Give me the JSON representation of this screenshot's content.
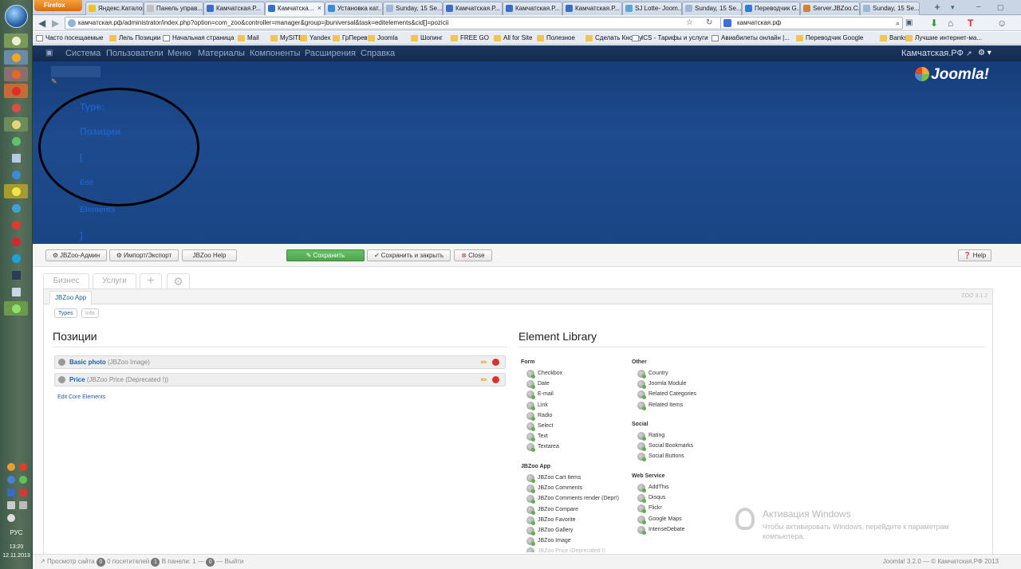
{
  "browser": {
    "menu_button": "Firefox",
    "tabs": [
      {
        "label": "Яндекс.Каталог"
      },
      {
        "label": "Панель управ..."
      },
      {
        "label": "Камчатская.Р..."
      },
      {
        "label": "Камчатска..."
      },
      {
        "label": "Установка кат..."
      },
      {
        "label": "Sunday, 15 Se..."
      },
      {
        "label": "Камчатская.Р..."
      },
      {
        "label": "Камчатская.Р..."
      },
      {
        "label": "Камчатская.Р..."
      },
      {
        "label": "SJ Lotte- Joom..."
      },
      {
        "label": "Sunday, 15 Se..."
      },
      {
        "label": "Переводчик G..."
      },
      {
        "label": "Server.JBZoo.C..."
      },
      {
        "label": "Sunday, 15 Se..."
      }
    ],
    "new_tab": "+",
    "url": "камчатская.рф/administrator/index.php?option=com_zoo&controller=manager&group=jbuniversal&task=editelements&cid[]=pozicii",
    "search": "камчатская.рф",
    "bookmarks": [
      "Часто посещаемые",
      "Лель Позиции",
      "Начальная страница",
      "Mail",
      "MySITE",
      "Yandex",
      "ГрПеревоз",
      "Joomla",
      "Шопинг",
      "FREE GO",
      "All for Site",
      "Полезное",
      "Сделать Кнопку",
      "ICS - Тарифы и услуги",
      "Авиабилеты онлайн |...",
      "Переводчик Google",
      "Banks",
      "Лучшие интернет-ма..."
    ]
  },
  "joomla": {
    "menu": [
      "Система",
      "Пользователи",
      "Меню",
      "Материалы",
      "Компоненты",
      "Расширения",
      "Справка"
    ],
    "site_name": "Камчатская.РФ",
    "logo_text": "Joomla!",
    "header_lines": [
      "Type:",
      "Позиции",
      "[",
      "Edit",
      "Elements",
      "]"
    ]
  },
  "toolbar": {
    "jbzoo_admin": "JBZoo-Админ",
    "import_export": "Импорт/Экспорт",
    "jbzoo_help": "JBZoo Help",
    "save": "Сохранить",
    "save_close": "Сохранить и закрыть",
    "close": "Close",
    "help": "Help"
  },
  "zoo": {
    "app_tabs": [
      "Бизнес",
      "Услуги"
    ],
    "sub_tab": "JBZoo App",
    "version": "ZOO 3.1.2",
    "pills": [
      "Types",
      "Info"
    ],
    "positions_title": "Позиции",
    "elements": [
      {
        "name": "Basic photo",
        "type": "(JBZoo Image)"
      },
      {
        "name": "Price",
        "type": "(JBZoo Price (Deprecated !))"
      }
    ],
    "edit_core": "Edit Core Elements",
    "library_title": "Element Library",
    "library": {
      "form": {
        "title": "Form",
        "items": [
          "Checkbox",
          "Date",
          "E-mail",
          "Link",
          "Radio",
          "Select",
          "Text",
          "Textarea"
        ]
      },
      "jbzoo": {
        "title": "JBZoo App",
        "items": [
          "JBZoo Cart Items",
          "JBZoo Comments",
          "JBZoo Comments render (Depr!)",
          "JBZoo Compare",
          "JBZoo Favorite",
          "JBZoo Gallery",
          "JBZoo Image",
          "JBZoo Price (Deprecated !)"
        ]
      },
      "other": {
        "title": "Other",
        "items": [
          "Country",
          "Joomla Module",
          "Related Categories",
          "Related Items"
        ]
      },
      "social": {
        "title": "Social",
        "items": [
          "Rating",
          "Social Bookmarks",
          "Social Buttons"
        ]
      },
      "web": {
        "title": "Web Service",
        "items": [
          "AddThis",
          "Disqus",
          "Flickr",
          "Google Maps",
          "IntenseDebate"
        ]
      }
    }
  },
  "windows_activation": {
    "title": "Активация Windows",
    "text": "Чтобы активировать Windows, перейдите к параметрам компьютера."
  },
  "statusbar": {
    "preview": "Просмотр сайта",
    "visitors_count": "0",
    "visitors": "посетителей",
    "panel_count": "1",
    "panel": "В панели:",
    "logout_count": "0",
    "logout": "Выйти",
    "footer": "Joomla! 3.2.0 — © Камчатская.РФ 2013"
  },
  "taskbar": {
    "lang": "РУС",
    "time": "13:20",
    "date": "12.11.2013"
  }
}
